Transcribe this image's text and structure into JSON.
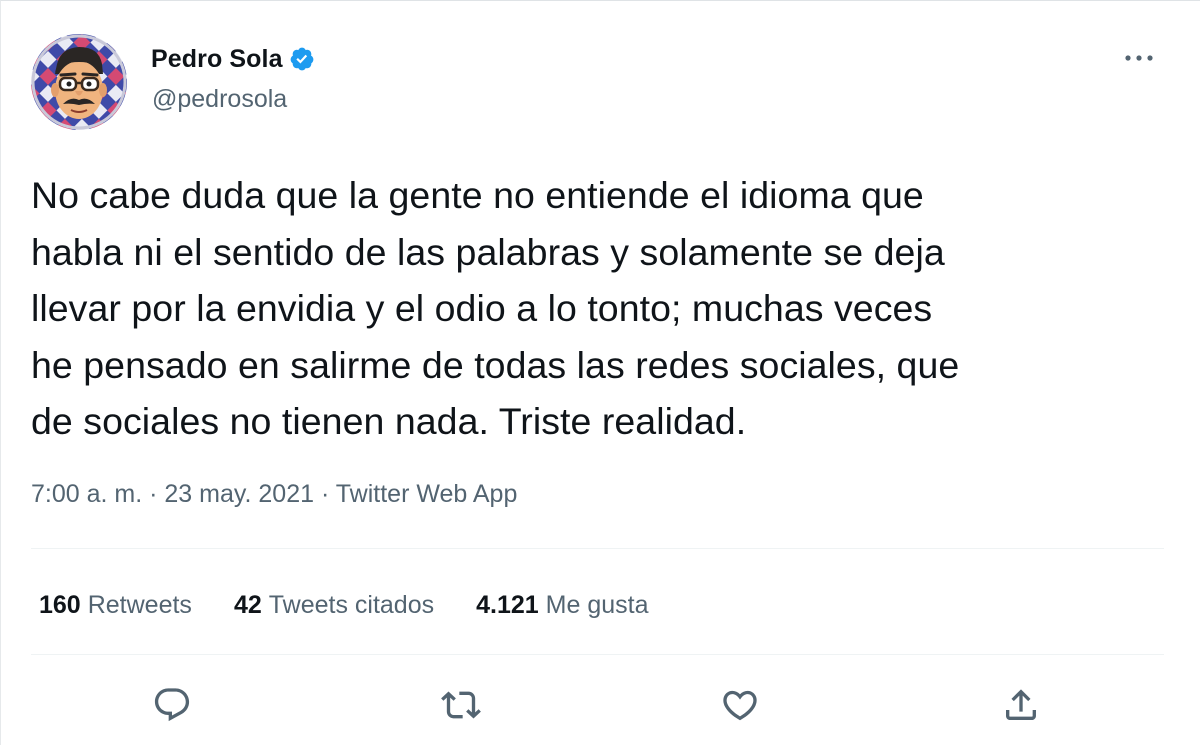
{
  "author": {
    "display_name": "Pedro Sola",
    "handle": "@pedrosola",
    "verified": true,
    "avatar_icon": "cartoon-avatar-icon",
    "verified_icon": "verified-badge-icon"
  },
  "tweet": {
    "text": "No cabe duda que la gente no entiende el idioma que\nhabla ni el sentido de las palabras y solamente se deja\nllevar por la envidia y el odio a lo tonto; muchas veces\nhe pensado en salirme de todas las redes sociales, que\nde sociales no tienen nada. Triste realidad.",
    "meta": "7:00 a. m. · 23 may. 2021 · Twitter Web App"
  },
  "stats": [
    {
      "count": "160",
      "label": "Retweets"
    },
    {
      "count": "42",
      "label": "Tweets citados"
    },
    {
      "count": "4.121",
      "label": "Me gusta"
    }
  ],
  "actions": [
    {
      "name": "reply",
      "icon": "reply-icon"
    },
    {
      "name": "retweet",
      "icon": "retweet-icon"
    },
    {
      "name": "like",
      "icon": "heart-icon"
    },
    {
      "name": "share",
      "icon": "share-icon"
    }
  ],
  "colors": {
    "text_primary": "#0f1419",
    "text_secondary": "#536471",
    "verified_blue": "#1d9bf0",
    "divider": "#eff3f4"
  }
}
